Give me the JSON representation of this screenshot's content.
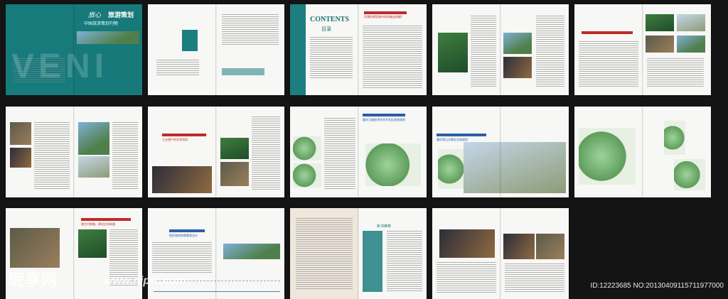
{
  "cover": {
    "logo_text": "旅心",
    "top_title": "旅游策划",
    "subtitle": "中国旅游策划刊物",
    "big_word": "VENI"
  },
  "contents": {
    "title": "CONTENTS",
    "subtitle": "目录"
  },
  "section_titles": {
    "s1": "资源枯竭型城市如何破茧成蝶?",
    "s2": "工业遗产的开发利用",
    "s3": "重庆万盛经济技术开发区旅游规划",
    "s4": "重庆黑山谷景区总体规划",
    "s5": "地形坡地地貌景观设计",
    "s6": "峨主村南路，建设文化新路",
    "s7": "新书推荐"
  },
  "watermark": {
    "site_name": "昵享网",
    "url": "www.nipic.com",
    "id_text": "ID:12223685 NO:20130409115711977000"
  }
}
